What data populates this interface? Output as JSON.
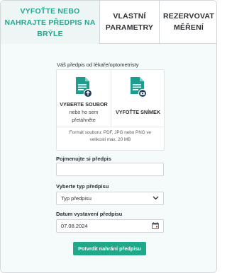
{
  "tabs": [
    {
      "label": "VYFOŤTE NEBO NAHRAJTE PŘEDPIS NA BRÝLE",
      "active": true
    },
    {
      "label": "VLASTNÍ PARAMETRY",
      "active": false
    },
    {
      "label": "REZERVOVAT MĚŘENÍ",
      "active": false
    }
  ],
  "upload": {
    "label": "Váš předpis od lékaře/optometristy",
    "file_option": {
      "title": "VYBERTE SOUBOR",
      "subtitle": "nebo ho sem přetáhněte",
      "icon": "document-upload-icon"
    },
    "photo_option": {
      "title": "VYFOŤTE SNÍMEK",
      "icon": "document-camera-icon"
    },
    "note": "Formát souboru: PDF, JPG nebo PNG ve velikosti max. 20 MB"
  },
  "form": {
    "name_label": "Pojmenujte si předpis",
    "name_value": "",
    "type_label": "Vyberte typ předpisu",
    "type_value": "Typ předpisu",
    "date_label": "Datum vystavení předpisu",
    "date_value": "07.08.2024",
    "submit_label": "Potvrdit nahrání předpisu"
  },
  "colors": {
    "accent": "#1fa98a",
    "accent_text": "#2aa38e",
    "panel_bg": "#f5fafa"
  }
}
